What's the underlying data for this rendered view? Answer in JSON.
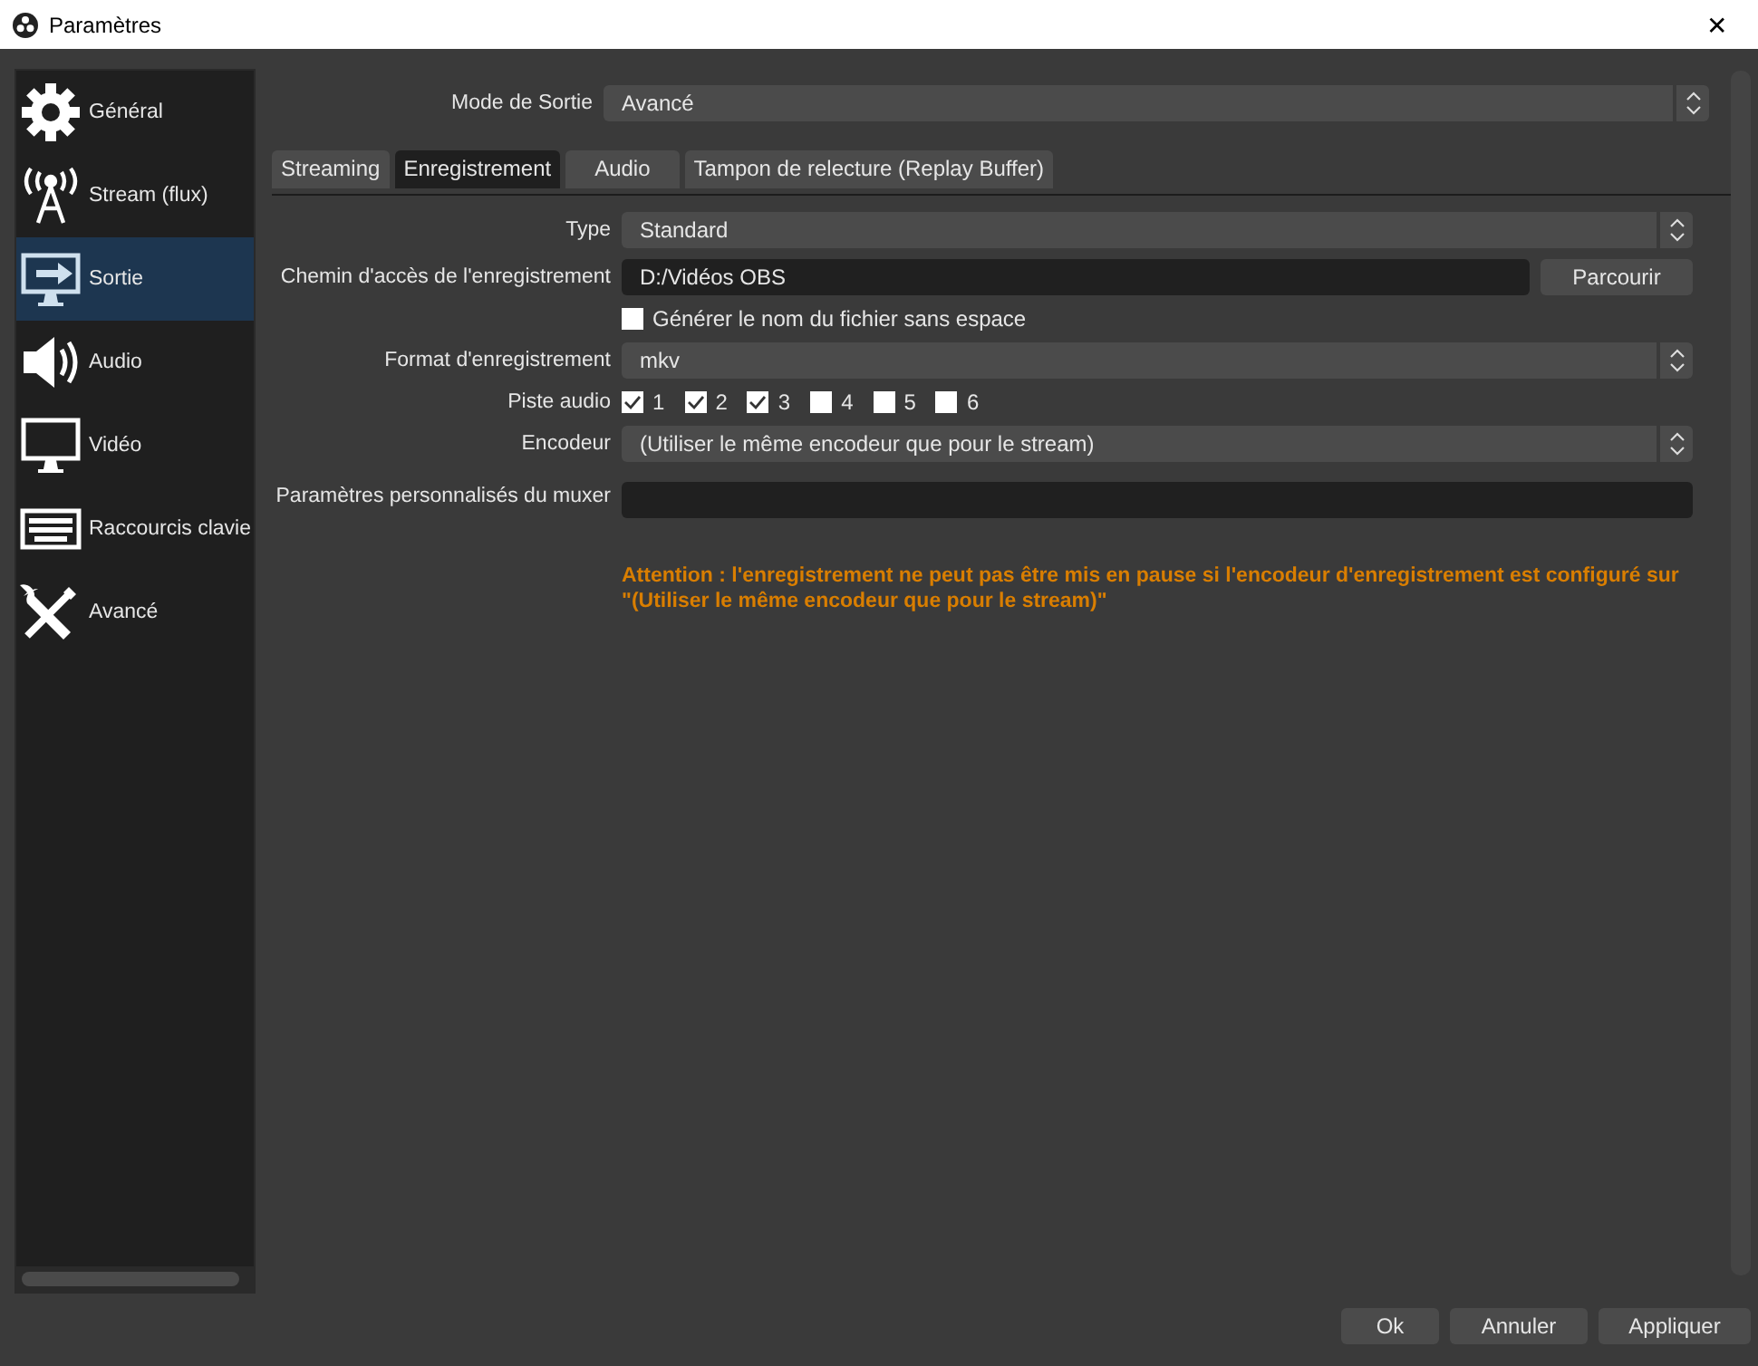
{
  "window": {
    "title": "Paramètres",
    "close": "✕"
  },
  "sidebar": {
    "items": [
      {
        "label": "Général",
        "selected": false
      },
      {
        "label": "Stream (flux)",
        "selected": false
      },
      {
        "label": "Sortie",
        "selected": true
      },
      {
        "label": "Audio",
        "selected": false
      },
      {
        "label": "Vidéo",
        "selected": false
      },
      {
        "label": "Raccourcis clavie",
        "selected": false
      },
      {
        "label": "Avancé",
        "selected": false
      }
    ]
  },
  "output_mode": {
    "label": "Mode de Sortie",
    "value": "Avancé"
  },
  "tabs": [
    {
      "label": "Streaming",
      "selected": false
    },
    {
      "label": "Enregistrement",
      "selected": true
    },
    {
      "label": "Audio",
      "selected": false
    },
    {
      "label": "Tampon de relecture (Replay Buffer)",
      "selected": false
    }
  ],
  "form": [
    {
      "kind": "select",
      "label": "Type",
      "value": "Standard"
    },
    {
      "kind": "path",
      "label": "Chemin d'accès de l'enregistrement",
      "value": "D:/Vidéos OBS",
      "button": "Parcourir"
    },
    {
      "kind": "checkbox",
      "text": "Générer le nom du fichier sans espace",
      "checked": false
    },
    {
      "kind": "select",
      "label": "Format d'enregistrement",
      "value": "mkv"
    },
    {
      "kind": "tracks",
      "label": "Piste audio",
      "tracks": [
        {
          "label": "1",
          "checked": true
        },
        {
          "label": "2",
          "checked": true
        },
        {
          "label": "3",
          "checked": true
        },
        {
          "label": "4",
          "checked": false
        },
        {
          "label": "5",
          "checked": false
        },
        {
          "label": "6",
          "checked": false
        }
      ]
    },
    {
      "kind": "select",
      "label": "Encodeur",
      "value": "(Utiliser le même encodeur que pour le stream)"
    },
    {
      "kind": "input",
      "label": "Paramètres personnalisés du muxer"
    }
  ],
  "warning": "Attention : l'enregistrement ne peut pas être mis en pause si l'encodeur d'enregistrement est configuré sur \"(Utiliser le même encodeur que pour le stream)\"",
  "buttons": [
    "Ok",
    "Annuler",
    "Appliquer"
  ]
}
